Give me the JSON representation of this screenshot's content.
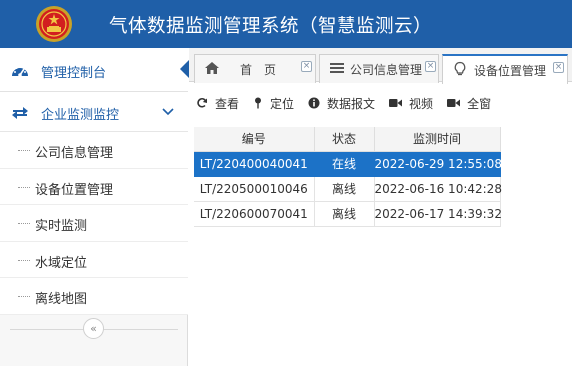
{
  "header": {
    "title": "气体数据监测管理系统（智慧监测云）",
    "emblem_icon": "national-emblem-icon"
  },
  "sidebar": {
    "top_item": {
      "label": "管理控制台",
      "icon": "dashboard-icon"
    },
    "group": {
      "label": "企业监测监控",
      "icon": "exchange-arrows-icon",
      "expanded": true
    },
    "sub_items": [
      {
        "label": "公司信息管理"
      },
      {
        "label": "设备位置管理"
      },
      {
        "label": "实时监测"
      },
      {
        "label": "水域定位"
      },
      {
        "label": "离线地图"
      }
    ],
    "collapse_glyph": "«"
  },
  "tabs": [
    {
      "label": "首　页",
      "icon": "home-icon",
      "active": false
    },
    {
      "label": "公司信息管理",
      "icon": "menu-icon",
      "active": false
    },
    {
      "label": "设备位置管理",
      "icon": "lightbulb-icon",
      "active": true
    }
  ],
  "toolbar": {
    "view": "查看",
    "locate": "定位",
    "data_report": "数据报文",
    "video": "视频",
    "full_window": "全窗"
  },
  "table": {
    "columns": [
      "编号",
      "状态",
      "监测时间"
    ],
    "rows": [
      {
        "id": "LT/220400040041",
        "status": "在线",
        "time": "2022-06-29 12:55:08",
        "selected": true
      },
      {
        "id": "LT/220500010046",
        "status": "离线",
        "time": "2022-06-16 10:42:28",
        "selected": false
      },
      {
        "id": "LT/220600070041",
        "status": "离线",
        "time": "2022-06-17 14:39:32",
        "selected": false
      }
    ]
  },
  "colors": {
    "brand": "#1f5fa8",
    "selected_row": "#1c72c7"
  }
}
